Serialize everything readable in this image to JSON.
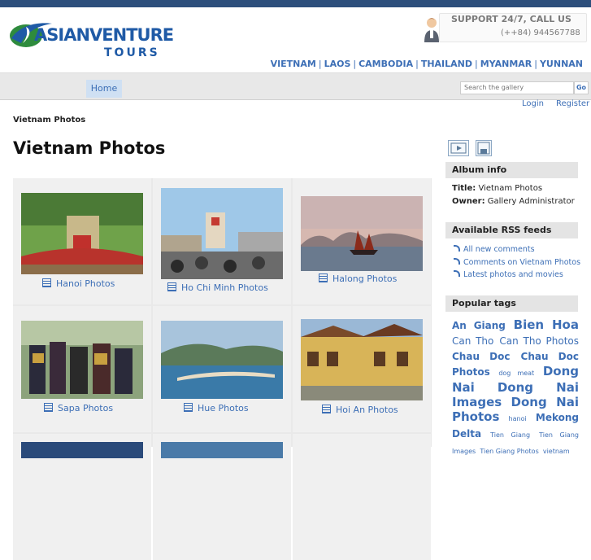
{
  "brand": {
    "name_part1": "ASIANVENTURE",
    "name_part2": "TOURS",
    "support_line1": "SUPPORT 24/7, CALL US",
    "support_line2": "(++84) 944567788"
  },
  "countries": [
    "VIETNAM",
    "LAOS",
    "CAMBODIA",
    "THAILAND",
    "MYANMAR",
    "YUNNAN"
  ],
  "nav": {
    "home": "Home",
    "search_placeholder": "Search the gallery",
    "go": "Go",
    "login": "Login",
    "register": "Register"
  },
  "breadcrumb": "Vietnam Photos",
  "page_title": "Vietnam Photos",
  "albums": [
    {
      "caption": "Hanoi Photos"
    },
    {
      "caption": "Ho Chi Minh Photos"
    },
    {
      "caption": "Halong Photos"
    },
    {
      "caption": "Sapa Photos"
    },
    {
      "caption": "Hue Photos"
    },
    {
      "caption": "Hoi An Photos"
    }
  ],
  "sidebar": {
    "album_info_title": "Album info",
    "title_label": "Title:",
    "title_value": "Vietnam Photos",
    "owner_label": "Owner:",
    "owner_value": "Gallery Administrator",
    "rss_title": "Available RSS feeds",
    "rss_items": [
      "All new comments",
      "Comments on Vietnam Photos",
      "Latest photos and movies"
    ],
    "tags_title": "Popular tags",
    "tags": [
      "An Giang",
      "Bien Hoa",
      "Can Tho",
      "Can Tho Photos",
      "Chau Doc",
      "Chau Doc Photos",
      "dog meat",
      "Dong Nai",
      "Dong Nai Images",
      "Dong Nai Photos",
      "hanoi",
      "Mekong Delta",
      "Tien Giang",
      "Tien Giang Images",
      "Tien Giang Photos",
      "vietnam"
    ]
  },
  "colors": {
    "topbar": "#2d4f7c",
    "link": "#3d6fb6",
    "nav_bg": "#e8e8e8",
    "sidebar_header": "#e4e4e4"
  }
}
